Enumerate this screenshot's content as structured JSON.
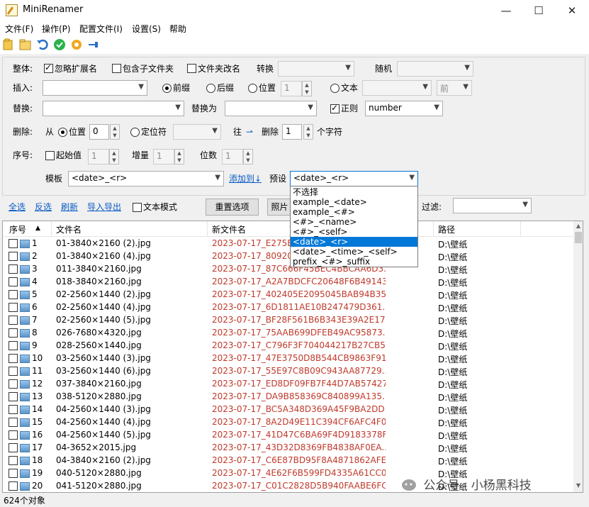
{
  "window": {
    "title": "MiniRenamer",
    "min_glyph": "—",
    "max_glyph": "☐",
    "close_glyph": "✕"
  },
  "menu": [
    "文件(F)",
    "操作(P)",
    "配置文件(I)",
    "设置(S)",
    "帮助"
  ],
  "toolbar": {
    "icons": [
      "open-folder-icon",
      "folder-icon",
      "undo-icon",
      "apply-check-icon",
      "settings-gear-icon",
      "pin-icon"
    ]
  },
  "options": {
    "overall": {
      "label": "整体:",
      "ignore_ext": "忽略扩展名",
      "include_sub": "包含子文件夹",
      "rename_folder": "文件夹改名",
      "convert": "转换",
      "random": "随机"
    },
    "insert": {
      "label": "插入:",
      "prefix": "前缀",
      "suffix": "后缀",
      "position": "位置",
      "position_value": "1",
      "text": "文本",
      "front": "前"
    },
    "replace": {
      "label": "替换:",
      "replace_with": "替换为",
      "regex": "正则",
      "regex_type": "number"
    },
    "delete": {
      "label": "删除:",
      "from": "从",
      "position": "位置",
      "position_value": "0",
      "locator": "定位符",
      "to": "往",
      "arrow": "⇀",
      "delete": "删除",
      "count": "1",
      "unit": "个字符"
    },
    "sequence": {
      "label": "序号:",
      "start": "起始值",
      "start_value": "1",
      "increment": "增量",
      "increment_value": "1",
      "digits": "位数",
      "digits_value": "1"
    },
    "template": {
      "label": "模板",
      "value": "<date>_<r>",
      "add_link": "添加到↓",
      "preset_label": "预设",
      "preset_value": "<date>_<r>"
    }
  },
  "actions": {
    "select_all": "全选",
    "invert": "反选",
    "refresh": "刷新",
    "import_export": "导入导出",
    "text_mode": "文本模式",
    "reset": "重置选项",
    "photo": "照片",
    "filter": "过滤:"
  },
  "preset_dropdown": [
    "不选择",
    "example_<date>",
    "example_<#>",
    "<#>_<name>",
    "<#>_<self>",
    "<date>_<r>",
    "<date>_<time>_<self>",
    "prefix_<#>_suffix"
  ],
  "preset_selected_index": 5,
  "list": {
    "headers": {
      "idx": "序号",
      "sort": "▲",
      "old": "文件名",
      "new": "新文件名",
      "path": "路径"
    },
    "rows": [
      {
        "idx": "1",
        "old": "01-3840×2160 (2).jpg",
        "new": "2023-07-17_E275B0",
        "path": "D:\\壁纸"
      },
      {
        "idx": "2",
        "old": "01-3840×2160 (4).jpg",
        "new": "2023-07-17_809209",
        "path": "D:\\壁纸"
      },
      {
        "idx": "3",
        "old": "011-3840×2160.jpg",
        "new": "2023-07-17_87C666F45BEC4BBCAA6D3...",
        "path": "D:\\壁纸"
      },
      {
        "idx": "4",
        "old": "018-3840×2160.jpg",
        "new": "2023-07-17_A2A7BDCFC20648F6B49143...",
        "path": "D:\\壁纸"
      },
      {
        "idx": "5",
        "old": "02-2560×1440 (2).jpg",
        "new": "2023-07-17_402405E2095045BAB94B35...",
        "path": "D:\\壁纸"
      },
      {
        "idx": "6",
        "old": "02-2560×1440 (4).jpg",
        "new": "2023-07-17_6D1811AE10B247479D361...",
        "path": "D:\\壁纸"
      },
      {
        "idx": "7",
        "old": "02-2560×1440 (5).jpg",
        "new": "2023-07-17_BF28F561B6B343E39A2E17...",
        "path": "D:\\壁纸"
      },
      {
        "idx": "8",
        "old": "026-7680×4320.jpg",
        "new": "2023-07-17_75AAB699DFEB49AC95873...",
        "path": "D:\\壁纸"
      },
      {
        "idx": "9",
        "old": "028-2560×1440.jpg",
        "new": "2023-07-17_C796F3F704044217B27CB5...",
        "path": "D:\\壁纸"
      },
      {
        "idx": "10",
        "old": "03-2560×1440 (3).jpg",
        "new": "2023-07-17_47E3750D8B544CB9863F91...",
        "path": "D:\\壁纸"
      },
      {
        "idx": "11",
        "old": "03-2560×1440 (6).jpg",
        "new": "2023-07-17_55E97C8B09C943AA87729...",
        "path": "D:\\壁纸"
      },
      {
        "idx": "12",
        "old": "037-3840×2160.jpg",
        "new": "2023-07-17_ED8DF09FB7F44D7AB57427...",
        "path": "D:\\壁纸"
      },
      {
        "idx": "13",
        "old": "038-5120×2880.jpg",
        "new": "2023-07-17_DA9B858369C840899A135...",
        "path": "D:\\壁纸"
      },
      {
        "idx": "14",
        "old": "04-2560×1440 (3).jpg",
        "new": "2023-07-17_BC5A348D369A45F9BA2DD...",
        "path": "D:\\壁纸"
      },
      {
        "idx": "15",
        "old": "04-2560×1440 (4).jpg",
        "new": "2023-07-17_8A2D49E11C394CF6AFC4F0...",
        "path": "D:\\壁纸"
      },
      {
        "idx": "16",
        "old": "04-2560×1440 (5).jpg",
        "new": "2023-07-17_41D47C6BA69F4D9183378F...",
        "path": "D:\\壁纸"
      },
      {
        "idx": "17",
        "old": "04-3652×2015.jpg",
        "new": "2023-07-17_43D32D8369FB4838AF0EA...",
        "path": "D:\\壁纸"
      },
      {
        "idx": "18",
        "old": "04-3840×2160 (2).jpg",
        "new": "2023-07-17_C6E87BD95F8A4871862AFE...",
        "path": "D:\\壁纸"
      },
      {
        "idx": "19",
        "old": "040-5120×2880.jpg",
        "new": "2023-07-17_4E62F6B599FD4335A61CC0...",
        "path": "D:\\壁纸"
      },
      {
        "idx": "20",
        "old": "041-5120×2880.jpg",
        "new": "2023-07-17_C01C2828D5B940FAABE6FC...",
        "path": "D:\\壁纸"
      }
    ]
  },
  "status": {
    "count": "624个对象"
  },
  "watermark": "公众号 · 小杨黑科技"
}
